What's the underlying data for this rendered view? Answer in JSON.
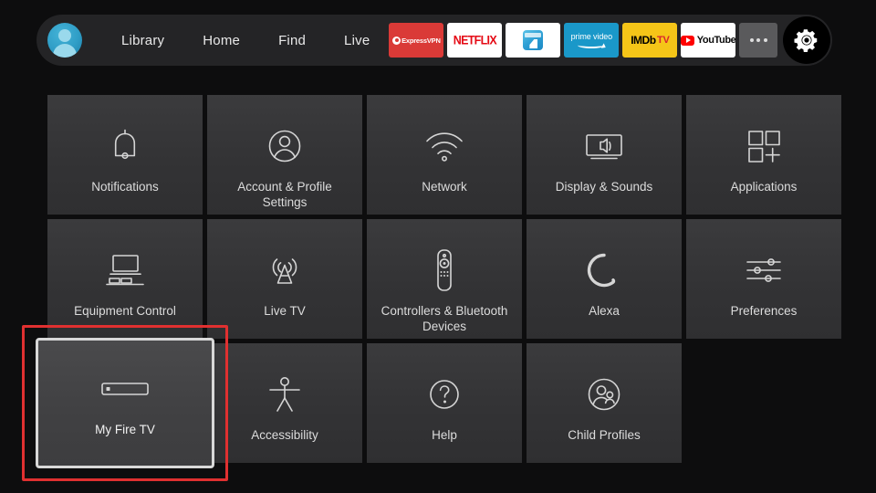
{
  "nav": {
    "avatar_label": "profile-avatar",
    "links": [
      "Library",
      "Home",
      "Find",
      "Live"
    ],
    "apps": [
      {
        "name": "ExpressVPN",
        "label": "ExpressVPN",
        "color": "#da3a37"
      },
      {
        "name": "Netflix",
        "label": "NETFLIX",
        "color": "#ffffff"
      },
      {
        "name": "ES File Explorer",
        "label": "",
        "color": "#ffffff"
      },
      {
        "name": "Prime Video",
        "label": "prime video",
        "color": "#1a98c9"
      },
      {
        "name": "IMDb TV",
        "label": "IMDb",
        "label2": "TV",
        "color": "#f5c518"
      },
      {
        "name": "YouTube",
        "label": "YouTube",
        "color": "#ffffff"
      },
      {
        "name": "More",
        "label": "•••",
        "color": "#5a5a5c"
      }
    ],
    "settings_button": "Settings"
  },
  "grid": {
    "rows": [
      [
        {
          "label": "Notifications",
          "icon": "bell-icon"
        },
        {
          "label": "Account & Profile Settings",
          "icon": "person-circle-icon"
        },
        {
          "label": "Network",
          "icon": "wifi-icon"
        },
        {
          "label": "Display & Sounds",
          "icon": "tv-speaker-icon"
        },
        {
          "label": "Applications",
          "icon": "app-squares-plus-icon"
        }
      ],
      [
        {
          "label": "Equipment Control",
          "icon": "tv-equipment-icon"
        },
        {
          "label": "Live TV",
          "icon": "antenna-icon"
        },
        {
          "label": "Controllers & Bluetooth Devices",
          "icon": "remote-control-icon"
        },
        {
          "label": "Alexa",
          "icon": "alexa-ring-icon"
        },
        {
          "label": "Preferences",
          "icon": "sliders-icon"
        }
      ],
      [
        {
          "label": "My Fire TV",
          "icon": "fire-tv-stick-icon",
          "focused": true
        },
        {
          "label": "Accessibility",
          "icon": "accessibility-person-icon"
        },
        {
          "label": "Help",
          "icon": "question-circle-icon"
        },
        {
          "label": "Child Profiles",
          "icon": "child-profiles-icon"
        }
      ]
    ]
  },
  "highlight": {
    "target": "My Fire TV",
    "color": "#e03030"
  }
}
